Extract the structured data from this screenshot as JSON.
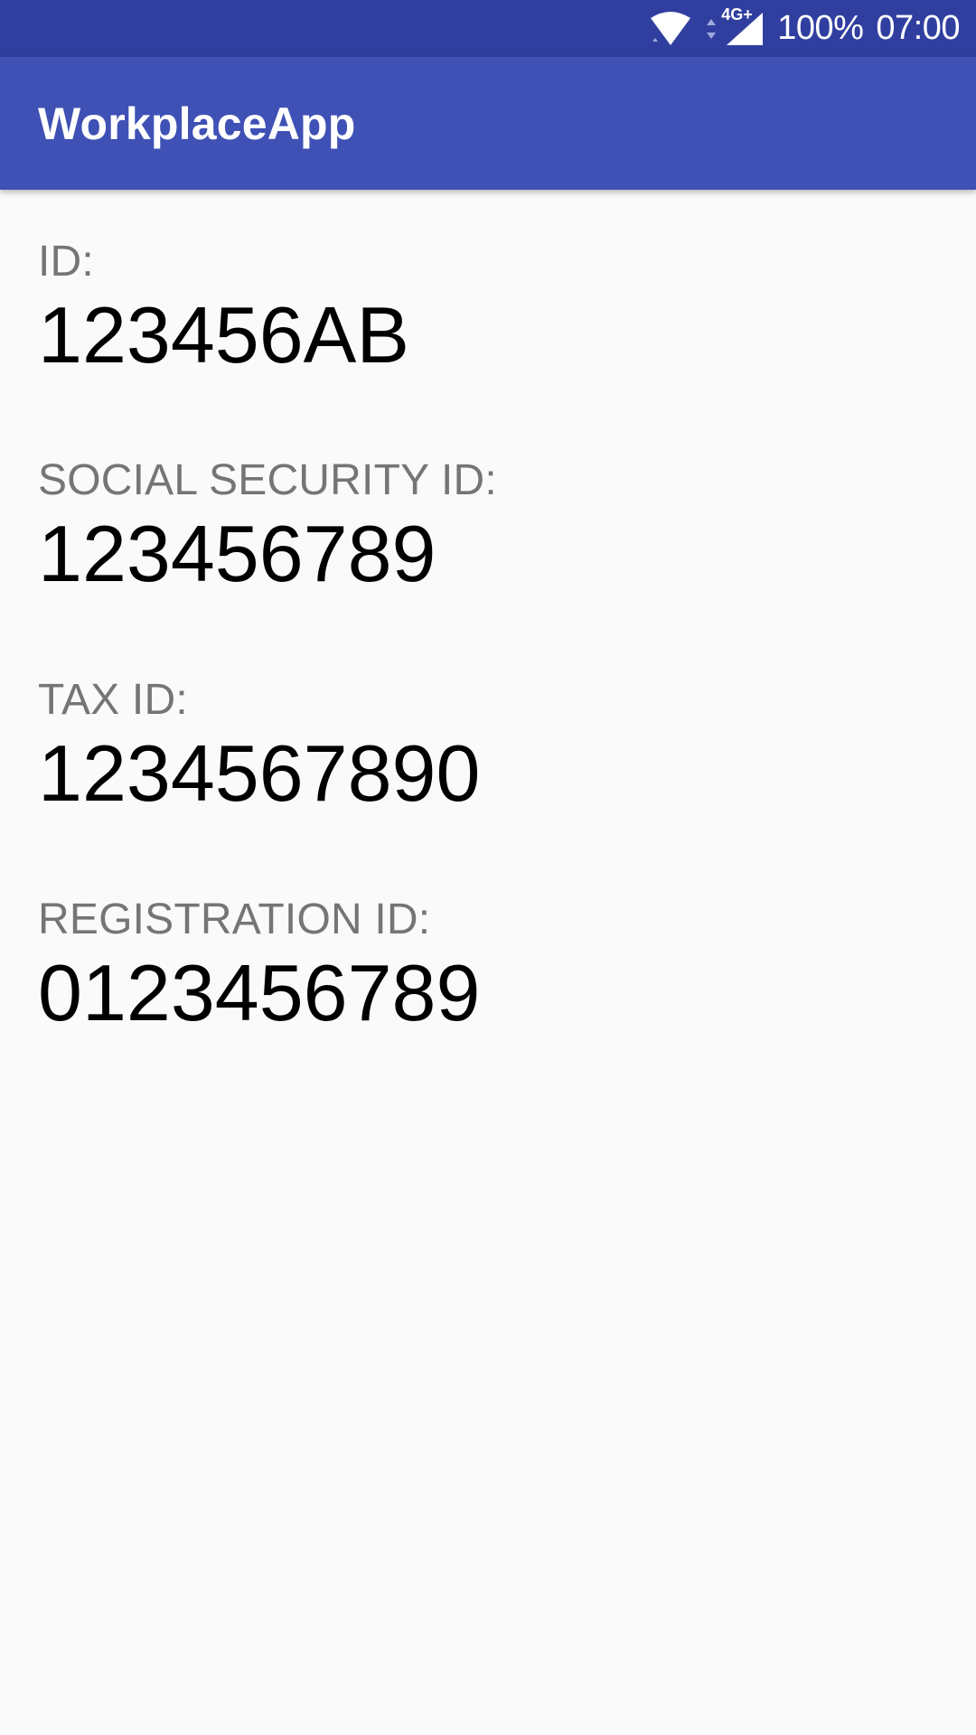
{
  "status_bar": {
    "network_label": "4G+",
    "battery": "100%",
    "time": "07:00",
    "icons": [
      "wifi-icon",
      "data-arrows-icon",
      "cell-signal-icon"
    ]
  },
  "app_bar": {
    "title": "WorkplaceApp",
    "color": "#3f51b5",
    "status_color": "#303f9f"
  },
  "fields": [
    {
      "label": "ID:",
      "value": "123456AB"
    },
    {
      "label": "SOCIAL SECURITY ID:",
      "value": "123456789"
    },
    {
      "label": "TAX ID:",
      "value": "1234567890"
    },
    {
      "label": "REGISTRATION ID:",
      "value": "0123456789"
    }
  ]
}
